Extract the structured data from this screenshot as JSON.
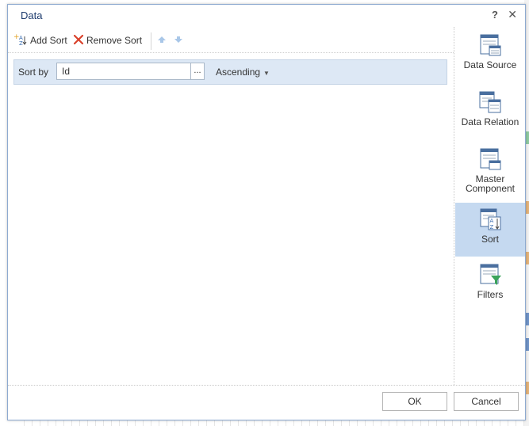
{
  "dialog": {
    "title": "Data"
  },
  "toolbar": {
    "add_sort": "Add Sort",
    "remove_sort": "Remove Sort"
  },
  "sort_row": {
    "label": "Sort by",
    "field_value": "Id",
    "browse": "...",
    "order": "Ascending"
  },
  "sidebar": {
    "items": [
      {
        "label": "Data Source",
        "icon": "data-source-icon"
      },
      {
        "label": "Data Relation",
        "icon": "data-relation-icon"
      },
      {
        "label": "Master Component",
        "icon": "master-component-icon"
      },
      {
        "label": "Sort",
        "icon": "sort-icon",
        "active": true
      },
      {
        "label": "Filters",
        "icon": "filters-icon"
      }
    ]
  },
  "footer": {
    "ok": "OK",
    "cancel": "Cancel"
  },
  "colors": {
    "accent": "#c5d9f0",
    "title": "#1e3c6e",
    "remove_red": "#d9412b"
  }
}
